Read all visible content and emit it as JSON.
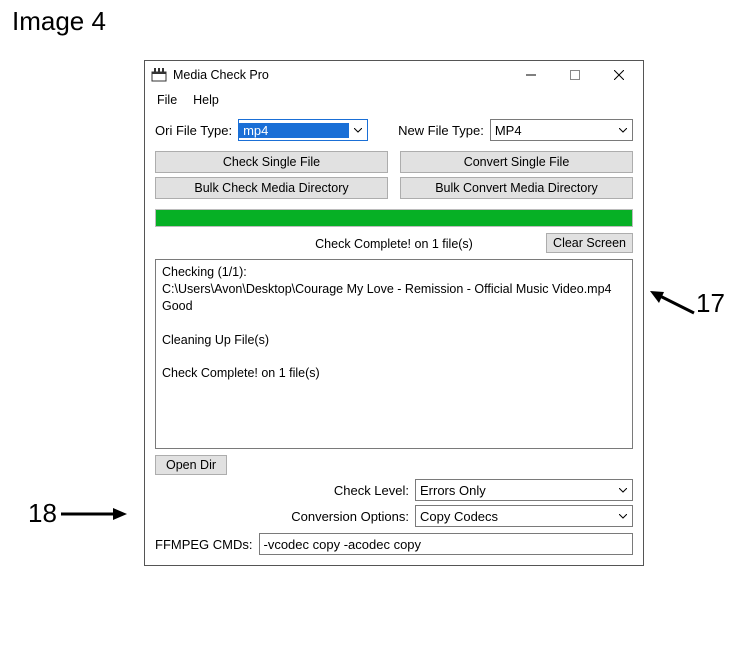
{
  "image_label": "Image 4",
  "window": {
    "title": "Media Check Pro",
    "menu": {
      "file": "File",
      "help": "Help"
    }
  },
  "filetype": {
    "ori_label": "Ori File Type:",
    "ori_value": "mp4",
    "new_label": "New File Type:",
    "new_value": "MP4"
  },
  "buttons": {
    "check_single": "Check Single File",
    "check_dir": "Bulk Check Media Directory",
    "convert_single": "Convert Single File",
    "convert_dir": "Bulk Convert Media Directory",
    "clear_screen": "Clear Screen",
    "open_dir": "Open Dir"
  },
  "status": "Check Complete! on 1 file(s)",
  "log": "Checking (1/1):\nC:\\Users\\Avon\\Desktop\\Courage My Love - Remission - Official Music Video.mp4\nGood\n\nCleaning Up File(s)\n\nCheck Complete! on 1 file(s)",
  "options": {
    "check_level_label": "Check Level:",
    "check_level_value": "Errors Only",
    "conv_opts_label": "Conversion Options:",
    "conv_opts_value": "Copy Codecs",
    "ffmpeg_label": "FFMPEG CMDs:",
    "ffmpeg_value": "-vcodec copy -acodec copy"
  },
  "callouts": {
    "n17": "17",
    "n18": "18"
  }
}
